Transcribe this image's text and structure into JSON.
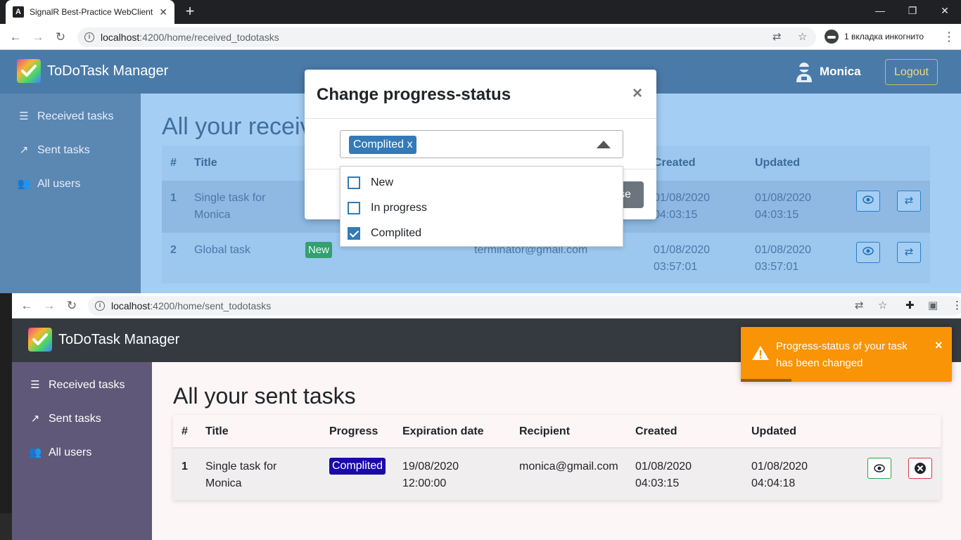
{
  "browser1": {
    "tab_title": "SignalR Best-Practice WebClient",
    "url_host": "localhost",
    "url_path": ":4200/home/received_todotasks",
    "incognito_label": "1 вкладка инкогнито"
  },
  "app1": {
    "brand": "ToDoTask Manager",
    "user_name": "Monica",
    "logout_label": "Logout",
    "sidebar": [
      {
        "label": "Received tasks",
        "icon": "task-list-icon"
      },
      {
        "label": "Sent tasks",
        "icon": "share-icon"
      },
      {
        "label": "All users",
        "icon": "users-icon"
      }
    ],
    "heading": "All your receiv",
    "columns": {
      "num": "#",
      "title": "Title",
      "created": "Created",
      "updated": "Updated"
    },
    "rows": [
      {
        "num": "1",
        "title_l1": "Single task for",
        "title_l2": "Monica",
        "created_l1": "01/08/2020",
        "created_l2": "04:03:15",
        "updated_l1": "01/08/2020",
        "updated_l2": "04:03:15"
      },
      {
        "num": "2",
        "title_l1": "Global task",
        "progress": "New",
        "sender": "terminator@gmail.com",
        "created_l1": "01/08/2020",
        "created_l2": "03:57:01",
        "updated_l1": "01/08/2020",
        "updated_l2": "03:57:01"
      }
    ]
  },
  "modal": {
    "title": "Change progress-status",
    "close_glyph": "×",
    "selected_chip": "Complited x",
    "footer_button_partial": "ose",
    "options": [
      {
        "label": "New",
        "checked": false
      },
      {
        "label": "In progress",
        "checked": false
      },
      {
        "label": "Complited",
        "checked": true
      }
    ]
  },
  "browser2": {
    "url_host": "localhost",
    "url_path": ":4200/home/sent_todotasks"
  },
  "app2": {
    "brand": "ToDoTask Manager",
    "sidebar": [
      {
        "label": "Received tasks",
        "icon": "task-list-icon"
      },
      {
        "label": "Sent tasks",
        "icon": "share-icon"
      },
      {
        "label": "All users",
        "icon": "users-icon"
      }
    ],
    "heading": "All your sent tasks",
    "columns": {
      "num": "#",
      "title": "Title",
      "progress": "Progress",
      "expiration": "Expiration date",
      "recipient": "Recipient",
      "created": "Created",
      "updated": "Updated"
    },
    "row": {
      "num": "1",
      "title_l1": "Single task for",
      "title_l2": "Monica",
      "progress": "Complited",
      "exp_l1": "19/08/2020",
      "exp_l2": "12:00:00",
      "recipient": "monica@gmail.com",
      "created_l1": "01/08/2020",
      "created_l2": "04:03:15",
      "updated_l1": "01/08/2020",
      "updated_l2": "04:04:18"
    }
  },
  "toast": {
    "message": "Progress-status of your task has been changed",
    "close_glyph": "×",
    "progress": 0.24
  },
  "colors": {
    "navbar1": "#4a7aa8",
    "navbar2": "#343a40",
    "toast": "#f89406",
    "badge_new": "#32a070",
    "badge_complited": "#1a0aa8"
  }
}
